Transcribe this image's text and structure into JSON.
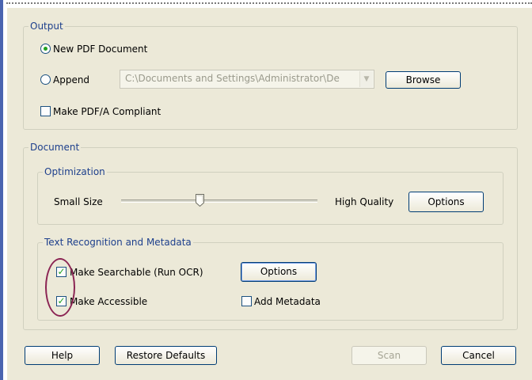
{
  "output": {
    "legend": "Output",
    "new_pdf_label": "New PDF Document",
    "append_label": "Append",
    "append_path": "C:\\Documents and Settings\\Administrator\\De",
    "browse_label": "Browse",
    "pdfa_label": "Make PDF/A Compliant"
  },
  "document": {
    "legend": "Document",
    "optimization": {
      "legend": "Optimization",
      "small_label": "Small Size",
      "high_label": "High Quality",
      "options_label": "Options",
      "slider_level": 0.4
    },
    "text_recognition": {
      "legend": "Text Recognition and Metadata",
      "searchable_label": "Make Searchable (Run OCR)",
      "options_label": "Options",
      "accessible_label": "Make Accessible",
      "metadata_label": "Add Metadata"
    }
  },
  "footer": {
    "help_label": "Help",
    "restore_label": "Restore Defaults",
    "scan_label": "Scan",
    "cancel_label": "Cancel"
  },
  "state": {
    "new_pdf_selected": true,
    "append_selected": false,
    "pdfa_checked": false,
    "searchable_checked": true,
    "accessible_checked": true,
    "metadata_checked": false,
    "scan_enabled": false
  },
  "colors": {
    "dialog_bg": "#ece9d8",
    "legend_text": "#1d3f8c",
    "check_green": "#21a121",
    "annotation_oval": "#8b2453",
    "accent_bar": "#4a64b0"
  },
  "icons": {
    "combo_arrow": "chevron-down-icon",
    "check_mark": "checkmark-icon",
    "radio_dot": "radio-dot-icon"
  }
}
